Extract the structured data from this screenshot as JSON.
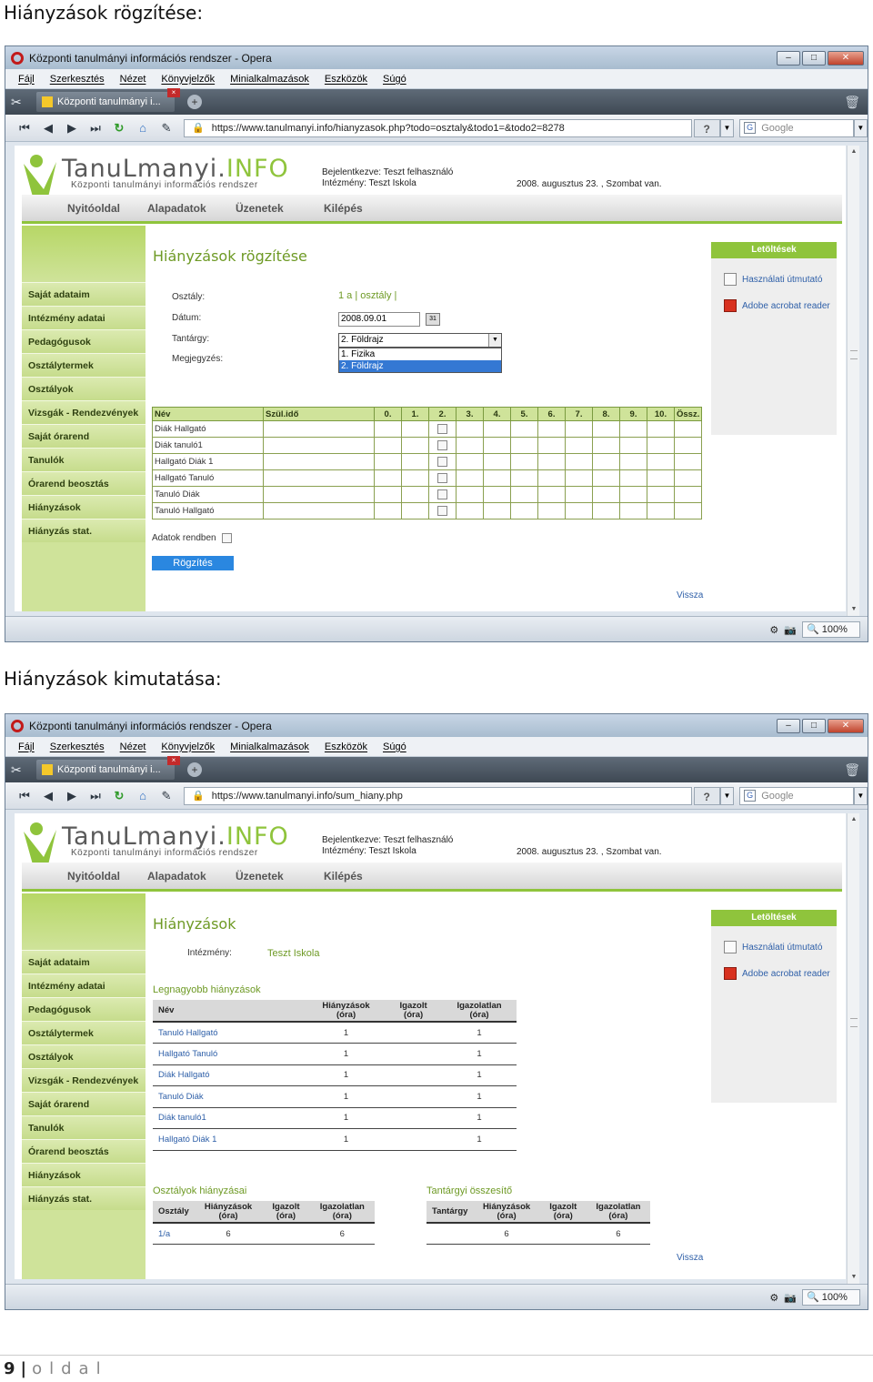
{
  "headings": {
    "screen1": "Hiányzások rögzítése:",
    "screen2": "Hiányzások kimutatása:"
  },
  "browser": {
    "window_title": "Központi tanulmányi információs rendszer - Opera",
    "menu": [
      "Fájl",
      "Szerkesztés",
      "Nézet",
      "Könyvjelzők",
      "Minialkalmazások",
      "Eszközök",
      "Súgó"
    ],
    "tab_title": "Központi tanulmányi i...",
    "search_placeholder": "Google",
    "zoom": "100%",
    "help_label": "?"
  },
  "site": {
    "logo_main": "TanuLmanyi.",
    "logo_info": "INFO",
    "logo_sub": "Központi tanulmányi információs rendszer",
    "login_line1": "Bejelentkezve: Teszt felhasználó",
    "login_line2": "Intézmény: Teszt Iskola",
    "date": "2008. augusztus 23. , Szombat van.",
    "nav": [
      "Nyitóoldal",
      "Alapadatok",
      "Üzenetek",
      "Kilépés"
    ],
    "sidebar": [
      "Saját adataim",
      "Intézmény adatai",
      "Pedagógusok",
      "Osztálytermek",
      "Osztályok",
      "Vizsgák - Rendezvények",
      "Saját órarend",
      "Tanulók",
      "Órarend beosztás",
      "Hiányzások",
      "Hiányzás stat."
    ],
    "downloads_title": "Letöltések",
    "downloads": [
      "Használati útmutató",
      "Adobe acrobat reader"
    ],
    "back_link": "Vissza"
  },
  "screen1": {
    "url": "https://www.tanulmanyi.info/hianyzasok.php?todo=osztaly&todo1=&todo2=8278",
    "title": "Hiányzások rögzítése",
    "label_class": "Osztály:",
    "value_class": "1 a | osztály |",
    "label_date": "Dátum:",
    "value_date": "2008.09.01",
    "label_subject": "Tantárgy:",
    "value_subject": "2. Földrajz",
    "subject_options": [
      "1. Fizika",
      "2. Földrajz"
    ],
    "label_note": "Megjegyzés:",
    "grid_headers": [
      "Név",
      "Szül.idő",
      "0.",
      "1.",
      "2.",
      "3.",
      "4.",
      "5.",
      "6.",
      "7.",
      "8.",
      "9.",
      "10.",
      "Össz."
    ],
    "students": [
      "Diák Hallgató",
      "Diák tanuló1",
      "Hallgató Diák 1",
      "Hallgató Tanuló",
      "Tanuló Diák",
      "Tanuló Hallgató"
    ],
    "ok_label": "Adatok rendben",
    "save_label": "Rögzítés"
  },
  "screen2": {
    "url": "https://www.tanulmanyi.info/sum_hiany.php",
    "title": "Hiányzások",
    "institution_label": "Intézmény:",
    "institution_value": "Teszt Iskola",
    "top_title": "Legnagyobb hiányzások",
    "top_headers": [
      "Név",
      "Hiányzások (óra)",
      "Igazolt (óra)",
      "Igazolatlan (óra)"
    ],
    "top_rows": [
      {
        "name": "Tanuló Hallgató",
        "total": "1",
        "excused": "",
        "unexcused": "1"
      },
      {
        "name": "Hallgató Tanuló",
        "total": "1",
        "excused": "",
        "unexcused": "1"
      },
      {
        "name": "Diák Hallgató",
        "total": "1",
        "excused": "",
        "unexcused": "1"
      },
      {
        "name": "Tanuló Diák",
        "total": "1",
        "excused": "",
        "unexcused": "1"
      },
      {
        "name": "Diák tanuló1",
        "total": "1",
        "excused": "",
        "unexcused": "1"
      },
      {
        "name": "Hallgató Diák 1",
        "total": "1",
        "excused": "",
        "unexcused": "1"
      }
    ],
    "class_title": "Osztályok hiányzásai",
    "class_headers": [
      "Osztály",
      "Hiányzások (óra)",
      "Igazolt (óra)",
      "Igazolatlan (óra)"
    ],
    "class_rows": [
      {
        "name": "1/a",
        "total": "6",
        "excused": "",
        "unexcused": "6"
      }
    ],
    "subject_title": "Tantárgyi összesítő",
    "subject_headers": [
      "Tantárgy",
      "Hiányzások (óra)",
      "Igazolt (óra)",
      "Igazolatlan (óra)"
    ],
    "subject_rows": [
      {
        "name": "",
        "total": "6",
        "excused": "",
        "unexcused": "6"
      }
    ]
  },
  "footer": {
    "page_number": "9",
    "separator": "|",
    "page_word": "oldal"
  }
}
